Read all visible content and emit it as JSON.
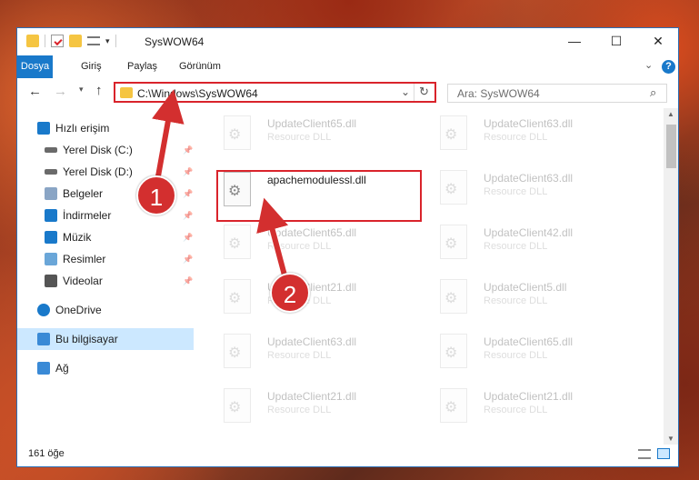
{
  "window": {
    "title": "SysWOW64",
    "minimize": "—",
    "maximize": "☐",
    "close": "✕"
  },
  "ribbon": {
    "tabs": [
      "Dosya",
      "Giriş",
      "Paylaş",
      "Görünüm"
    ]
  },
  "address": {
    "path": "C:\\Windows\\SysWOW64",
    "search_placeholder": "Ara: SysWOW64"
  },
  "sidebar": {
    "items": [
      {
        "label": "Hızlı erişim",
        "icon": "star-icon"
      },
      {
        "label": "Yerel Disk (C:)",
        "icon": "drive-icon",
        "pinned": true
      },
      {
        "label": "Yerel Disk (D:)",
        "icon": "drive-icon",
        "pinned": true
      },
      {
        "label": "Belgeler",
        "icon": "documents-icon",
        "pinned": true
      },
      {
        "label": "İndirmeler",
        "icon": "download-icon",
        "pinned": true
      },
      {
        "label": "Müzik",
        "icon": "music-icon",
        "pinned": true
      },
      {
        "label": "Resimler",
        "icon": "pictures-icon",
        "pinned": true
      },
      {
        "label": "Videolar",
        "icon": "videos-icon",
        "pinned": true
      },
      {
        "label": "OneDrive",
        "icon": "cloud-icon"
      },
      {
        "label": "Bu bilgisayar",
        "icon": "computer-icon",
        "selected": true
      },
      {
        "label": "Ağ",
        "icon": "network-icon"
      }
    ]
  },
  "files": {
    "highlighted": {
      "name": "apachemodulessl.dll"
    },
    "left": [
      {
        "name": "UpdateClient65.dll",
        "desc": "Resource DLL"
      },
      {
        "name": "UpdateClient65.dll",
        "desc": "Resource DLL"
      },
      {
        "name": "UpdateClient21.dll",
        "desc": "Resource DLL"
      },
      {
        "name": "UpdateClient63.dll",
        "desc": "Resource DLL"
      },
      {
        "name": "UpdateClient21.dll",
        "desc": "Resource DLL"
      }
    ],
    "right": [
      {
        "name": "UpdateClient63.dll",
        "desc": "Resource DLL"
      },
      {
        "name": "UpdateClient63.dll",
        "desc": "Resource DLL"
      },
      {
        "name": "UpdateClient42.dll",
        "desc": "Resource DLL"
      },
      {
        "name": "UpdateClient5.dll",
        "desc": "Resource DLL"
      },
      {
        "name": "UpdateClient65.dll",
        "desc": "Resource DLL"
      },
      {
        "name": "UpdateClient21.dll",
        "desc": "Resource DLL"
      }
    ]
  },
  "status": {
    "count": "161 öğe"
  },
  "callouts": [
    "1",
    "2"
  ],
  "colors": {
    "accent": "#1979ca",
    "highlight": "#d9232b",
    "selected": "#cce8ff"
  }
}
